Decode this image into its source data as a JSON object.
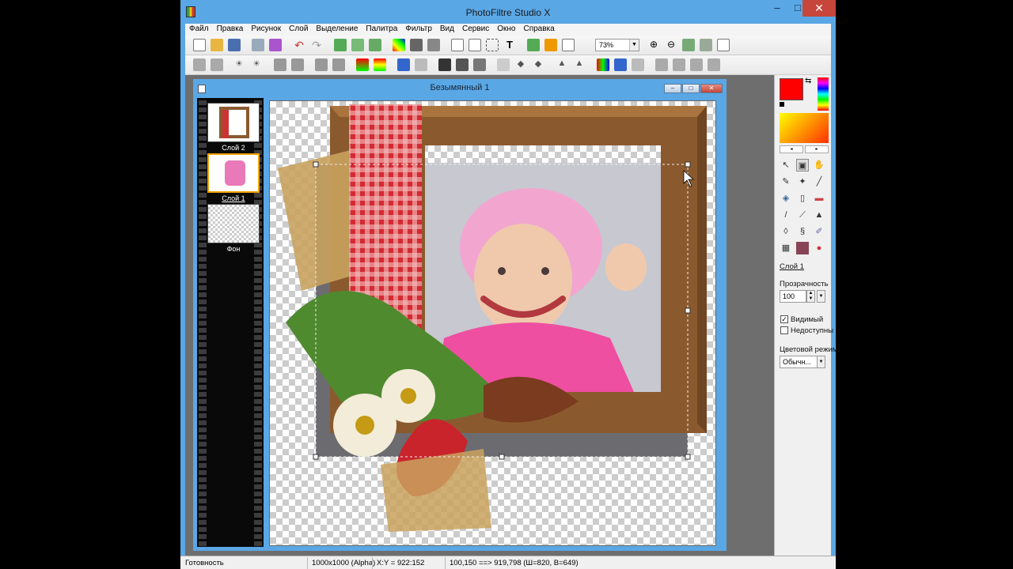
{
  "window": {
    "title": "PhotoFiltre Studio X"
  },
  "menu": [
    "Файл",
    "Правка",
    "Рисунок",
    "Слой",
    "Выделение",
    "Палитра",
    "Фильтр",
    "Вид",
    "Сервис",
    "Окно",
    "Справка"
  ],
  "toolbar": {
    "zoom": "73%"
  },
  "document": {
    "title": "Безымянный 1"
  },
  "layers": [
    {
      "label": "Слой 2"
    },
    {
      "label": "Слой 1",
      "selected": true
    },
    {
      "label": "Фон"
    }
  ],
  "right_panel": {
    "layer_name": "Слой 1",
    "opacity_label": "Прозрачность",
    "opacity_value": "100",
    "visible_label": "Видимый",
    "visible_checked": true,
    "locked_label": "Недоступны",
    "locked_checked": false,
    "blend_label": "Цветовой режим",
    "blend_value": "Обычн..."
  },
  "colors": {
    "foreground": "#ff0000",
    "background": "#ffffff",
    "accent": "#5aa7e6"
  },
  "status": {
    "ready": "Готовность",
    "size": "1000x1000 (Alpha)",
    "coords": "X:Y = 922:152",
    "selection": "100,150 ==> 919,798 (Ш=820, В=649)"
  }
}
